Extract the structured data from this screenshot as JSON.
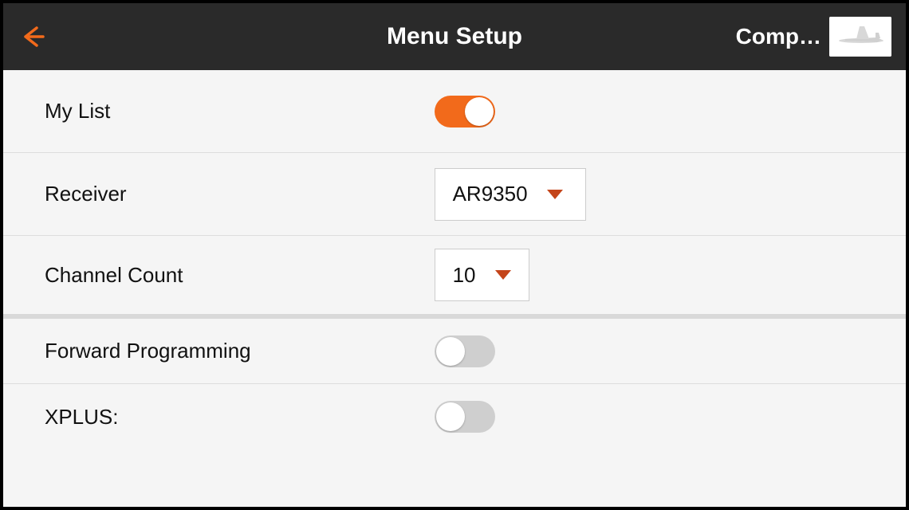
{
  "header": {
    "title": "Menu Setup",
    "model_name": "Comp…"
  },
  "rows": {
    "my_list": {
      "label": "My List",
      "state": "on"
    },
    "receiver": {
      "label": "Receiver",
      "value": "AR9350"
    },
    "channel_count": {
      "label": "Channel Count",
      "value": "10"
    },
    "forward_programming": {
      "label": "Forward Programming",
      "state": "off"
    },
    "xplus": {
      "label": "XPLUS:",
      "state": "off"
    }
  },
  "colors": {
    "accent": "#f26a1b",
    "caret": "#c4451a",
    "header_bg": "#2a2a2a"
  }
}
